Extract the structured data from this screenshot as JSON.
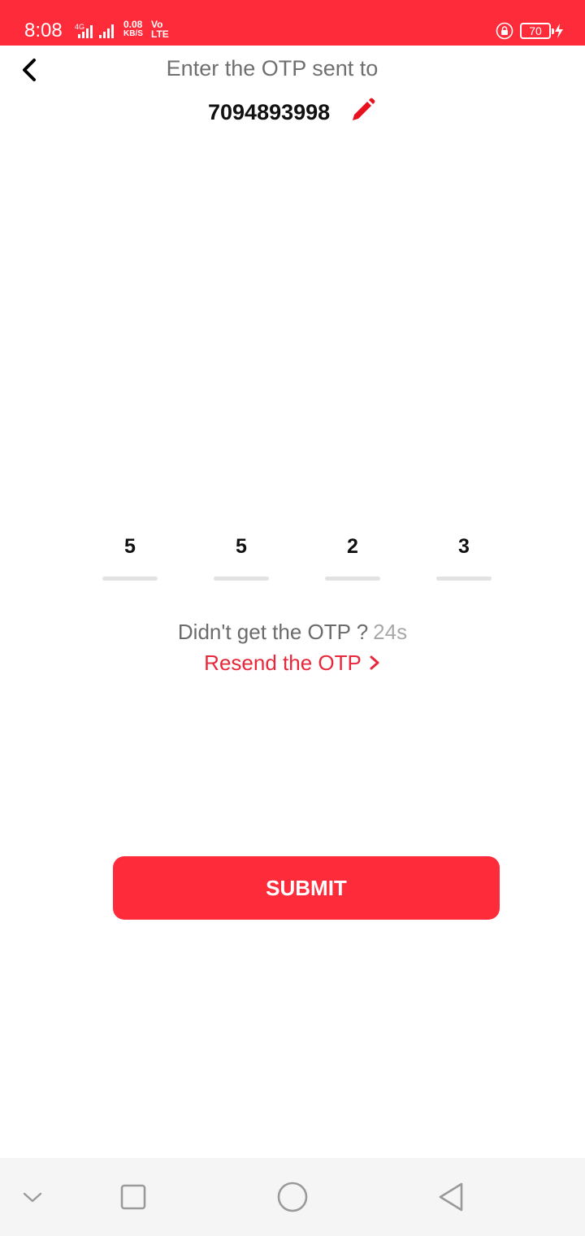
{
  "status_bar": {
    "time": "8:08",
    "network_icon": "signal-icon",
    "speed_value": "0.08",
    "speed_unit": "KB/S",
    "volte_top": "Vo",
    "volte_bottom": "LTE",
    "battery": "70",
    "color": "#fe2b3b"
  },
  "header": {
    "back_icon": "back-arrow-icon",
    "title": "Enter the OTP sent to",
    "phone_number": "7094893998",
    "edit_icon": "pencil-icon"
  },
  "otp": {
    "digits": [
      "5",
      "5",
      "2",
      "3"
    ]
  },
  "resend": {
    "question": "Didn't get the OTP ?",
    "timer": "24s",
    "link_label": "Resend the OTP"
  },
  "submit_label": "SUBMIT",
  "nav_bar": {
    "buttons": [
      "chevron-down-icon",
      "recents-square-icon",
      "home-circle-icon",
      "back-triangle-icon"
    ]
  },
  "colors": {
    "accent": "#fe2b3b",
    "link": "#e8273a"
  }
}
